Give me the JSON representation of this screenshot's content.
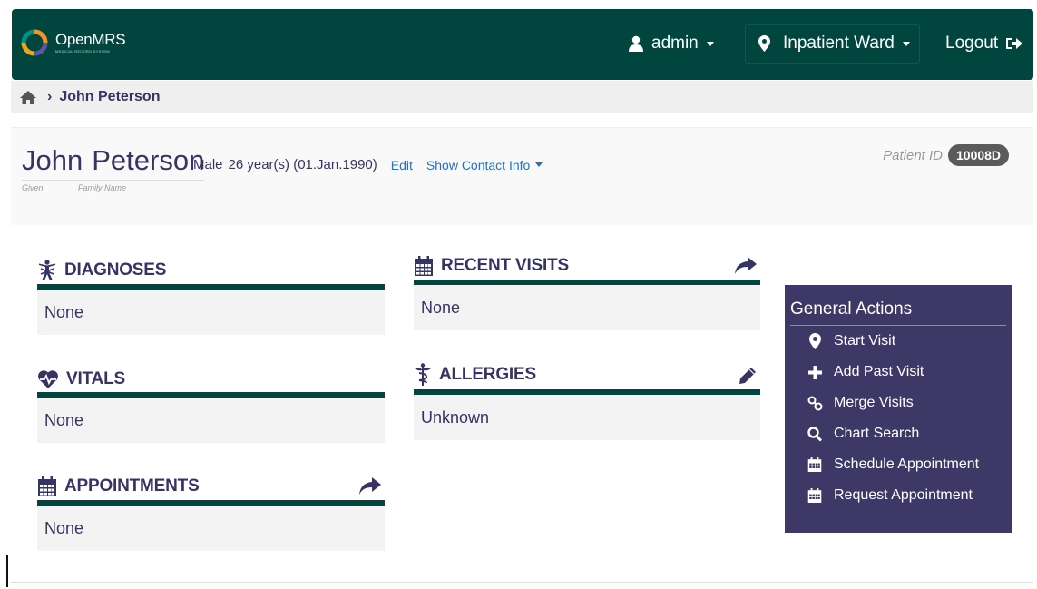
{
  "header": {
    "logo_name": "OpenMRS",
    "logo_tagline": "MEDICAL RECORD SYSTEM",
    "user": "admin",
    "location": "Inpatient Ward",
    "logout": "Logout"
  },
  "breadcrumb": {
    "current": "John Peterson"
  },
  "patient": {
    "given": "John",
    "family": "Peterson",
    "given_label": "Given",
    "family_label": "Family Name",
    "gender": "Male",
    "age": "26 year(s) (01.Jan.1990)",
    "edit": "Edit",
    "contact_info": "Show Contact Info",
    "id_label": "Patient ID",
    "id_value": "10008D"
  },
  "sections": {
    "diagnoses": {
      "title": "DIAGNOSES",
      "value": "None"
    },
    "vitals": {
      "title": "VITALS",
      "value": "None"
    },
    "appointments": {
      "title": "APPOINTMENTS",
      "value": "None"
    },
    "recent_visits": {
      "title": "RECENT VISITS",
      "value": "None"
    },
    "allergies": {
      "title": "ALLERGIES",
      "value": "Unknown"
    }
  },
  "general_actions": {
    "title": "General Actions",
    "items": [
      {
        "label": "Start Visit",
        "icon": "map-marker-icon"
      },
      {
        "label": "Add Past Visit",
        "icon": "plus-icon"
      },
      {
        "label": "Merge Visits",
        "icon": "link-icon"
      },
      {
        "label": "Chart Search",
        "icon": "search-icon"
      },
      {
        "label": "Schedule Appointment",
        "icon": "calendar-icon"
      },
      {
        "label": "Request Appointment",
        "icon": "calendar-icon"
      }
    ]
  },
  "colors": {
    "header_bg": "#00463f",
    "text": "#363463",
    "actions_bg": "#3e3867",
    "link": "#2b6fb5"
  }
}
